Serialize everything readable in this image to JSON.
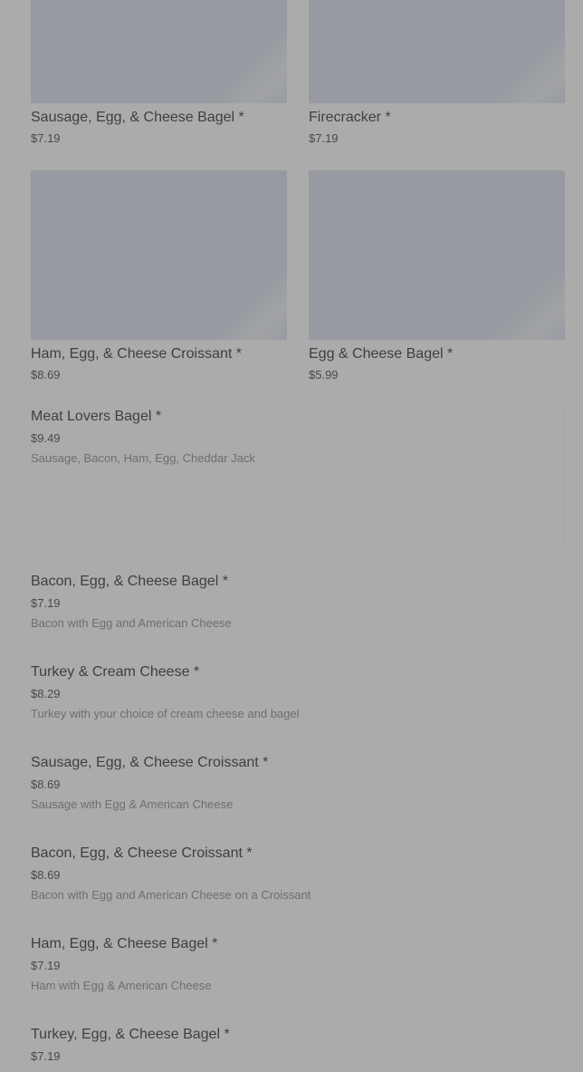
{
  "grid_items": [
    {
      "name": "Sausage, Egg, & Cheese Bagel *",
      "price": "$7.19"
    },
    {
      "name": "Firecracker *",
      "price": "$7.19"
    },
    {
      "name": "Ham, Egg, & Cheese Croissant *",
      "price": "$8.69"
    },
    {
      "name": "Egg & Cheese Bagel *",
      "price": "$5.99"
    }
  ],
  "list_items": [
    {
      "name": "Meat Lovers Bagel *",
      "price": "$9.49",
      "desc": "Sausage, Bacon, Ham, Egg, Cheddar Jack"
    },
    {
      "name": "Bacon, Egg, & Cheese Bagel *",
      "price": "$7.19",
      "desc": "Bacon with Egg and American Cheese"
    },
    {
      "name": "Turkey & Cream Cheese *",
      "price": "$8.29",
      "desc": "Turkey with your choice of cream cheese and bagel"
    },
    {
      "name": "Sausage, Egg, & Cheese Croissant *",
      "price": "$8.69",
      "desc": "Sausage with Egg & American Cheese"
    },
    {
      "name": "Bacon, Egg, & Cheese Croissant *",
      "price": "$8.69",
      "desc": "Bacon with Egg and American Cheese on a Croissant"
    },
    {
      "name": "Ham, Egg, & Cheese Bagel *",
      "price": "$7.19",
      "desc": "Ham with Egg & American Cheese"
    },
    {
      "name": "Turkey, Egg, & Cheese Bagel *",
      "price": "$7.19",
      "desc": ""
    }
  ]
}
